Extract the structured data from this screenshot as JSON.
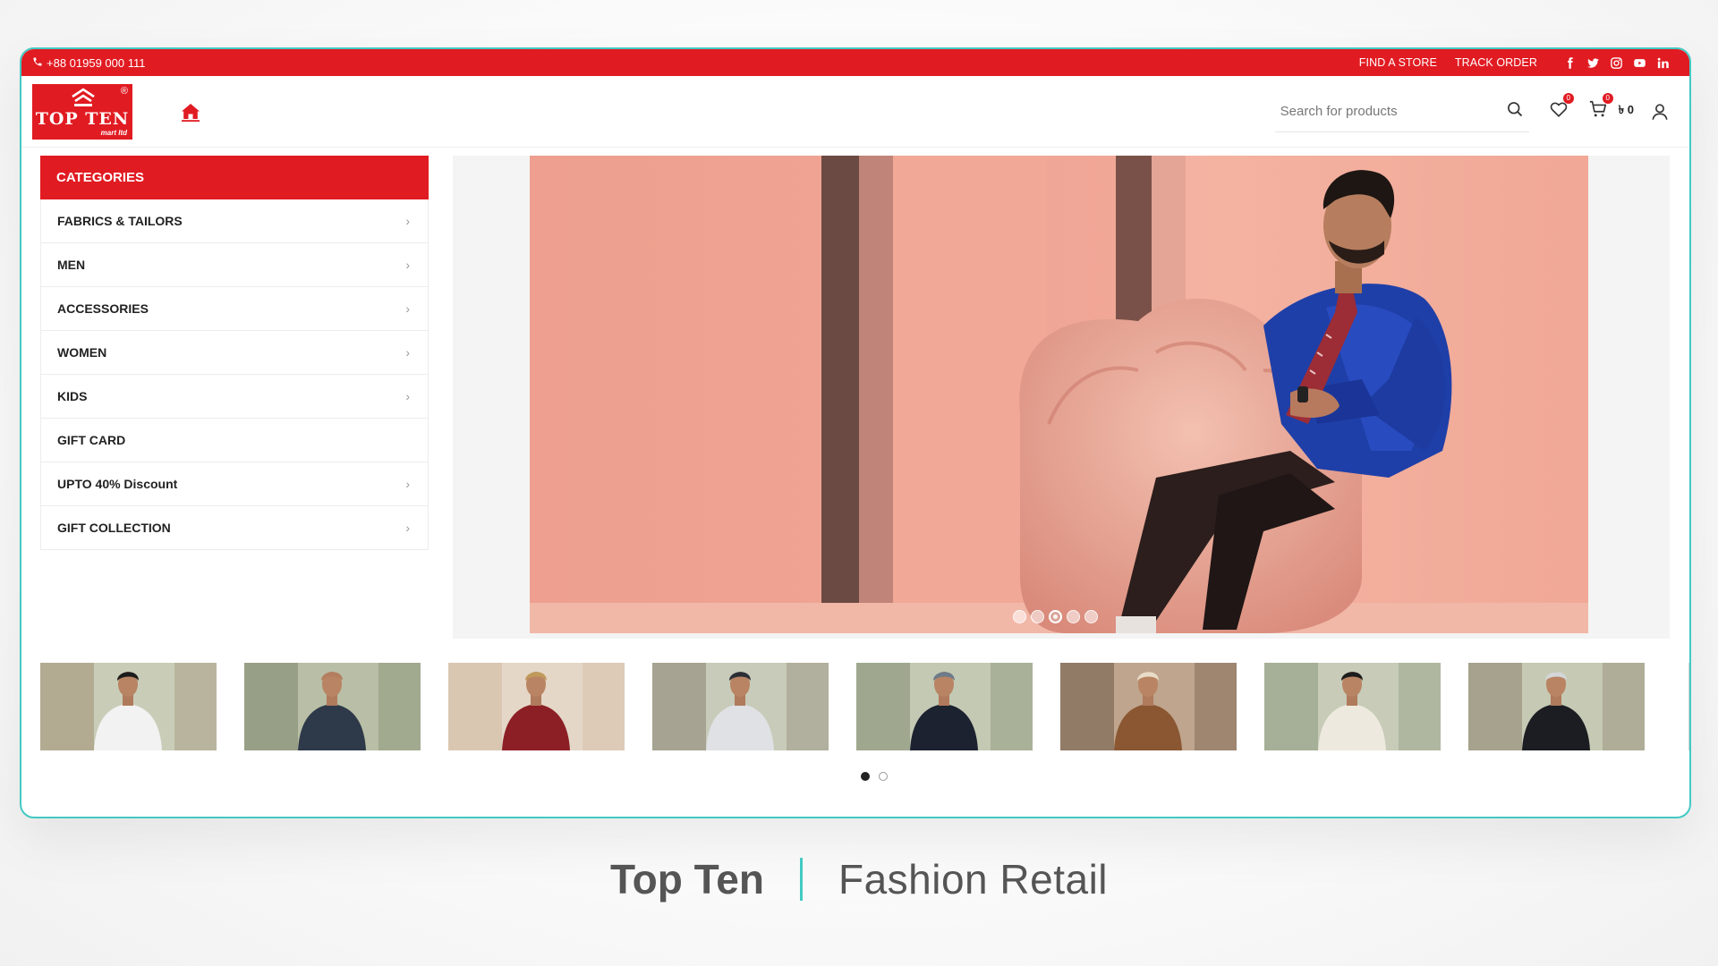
{
  "topbar": {
    "phone": "+88 01959 000 111",
    "links": [
      "FIND A STORE",
      "TRACK ORDER"
    ],
    "socials": [
      "facebook-icon",
      "twitter-icon",
      "instagram-icon",
      "youtube-icon",
      "linkedin-icon"
    ]
  },
  "header": {
    "logo": {
      "name": "TOP TEN",
      "sub": "mart ltd",
      "reg": "®"
    },
    "search_placeholder": "Search for products",
    "wishlist_count": "0",
    "cart_count": "0",
    "cart_total": "৳ 0"
  },
  "categories": {
    "title": "CATEGORIES",
    "items": [
      {
        "label": "FABRICS & TAILORS",
        "chevron": true
      },
      {
        "label": "MEN",
        "chevron": true
      },
      {
        "label": "ACCESSORIES",
        "chevron": true
      },
      {
        "label": "WOMEN",
        "chevron": true
      },
      {
        "label": "KIDS",
        "chevron": true
      },
      {
        "label": "GIFT CARD",
        "chevron": false
      },
      {
        "label": "UPTO 40% Discount",
        "chevron": true
      },
      {
        "label": "GIFT COLLECTION",
        "chevron": true
      }
    ]
  },
  "slider": {
    "total_slides": 5,
    "active_slide": 3
  },
  "thumbnails": {
    "count": 8,
    "pages": 2,
    "active_page": 1
  },
  "caption": {
    "brand": "Top Ten",
    "tagline": "Fashion Retail"
  },
  "colors": {
    "brand_red": "#e11b22",
    "frame_teal": "#43c9c4"
  }
}
